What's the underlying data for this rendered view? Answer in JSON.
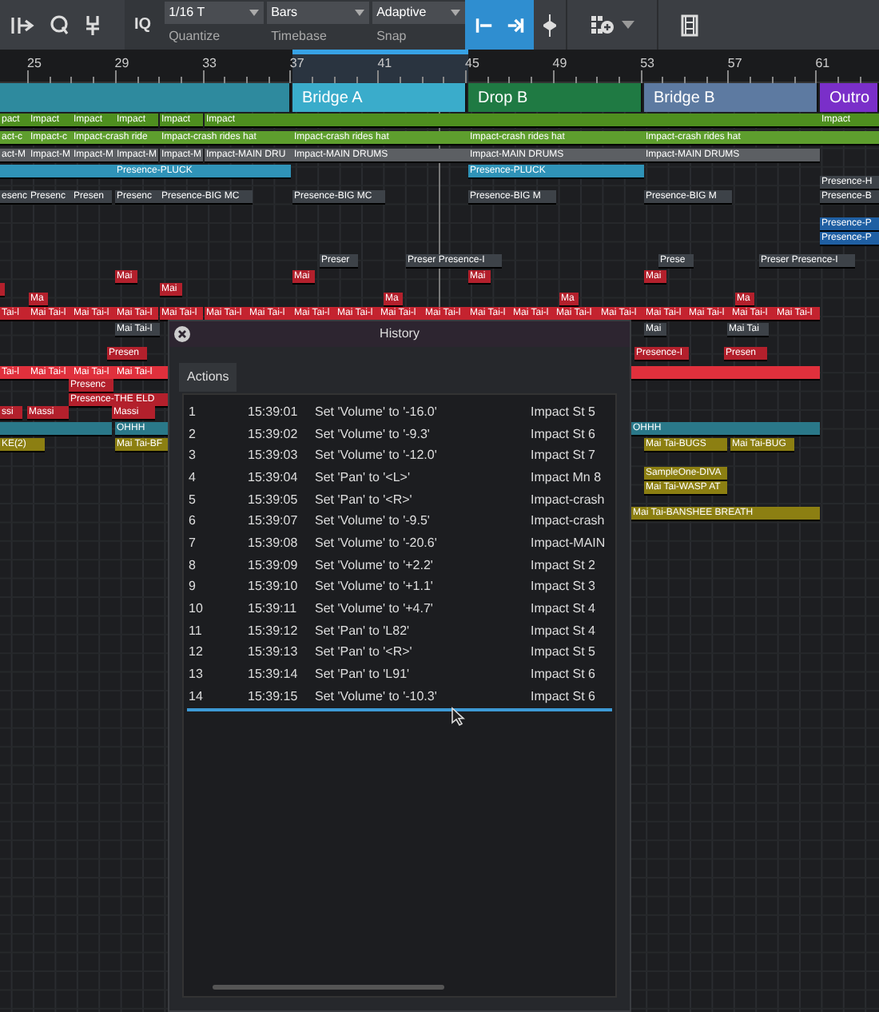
{
  "toolbar": {
    "quantize_label": "IQ",
    "dropdowns": [
      {
        "value": "1/16 T",
        "caption": "Quantize"
      },
      {
        "value": "Bars",
        "caption": "Timebase"
      },
      {
        "value": "Adaptive",
        "caption": "Snap"
      }
    ]
  },
  "ruler": [
    "25",
    "29",
    "33",
    "37",
    "41",
    "45",
    "49",
    "53",
    "57",
    "61"
  ],
  "sections": [
    {
      "color": "#2e8a9e"
    },
    {
      "label": "Bridge A",
      "color": "#3aaccb"
    },
    {
      "label": "Drop B",
      "color": "#1f7a43"
    },
    {
      "label": "Bridge B",
      "color": "#5d7aa1"
    },
    {
      "label": "Outro",
      "color": "#7a2fc9"
    }
  ],
  "lanes": [
    {
      "color": "#4e8f1f",
      "clips": [
        {
          "kind": "clip",
          "label": "pact"
        },
        {
          "kind": "clip",
          "label": "Impact"
        },
        {
          "kind": "clip",
          "label": "Impact"
        },
        {
          "kind": "clip",
          "label": "Impact"
        },
        {
          "kind": "clip",
          "label": "Impact"
        },
        {
          "kind": "clip",
          "label": "Impact"
        },
        {
          "kind": "bar"
        },
        {
          "kind": "clip",
          "label": "Impact"
        }
      ]
    },
    {
      "color": "#5e9e2e",
      "clips": [
        {
          "kind": "clip",
          "label": "act-c"
        },
        {
          "kind": "clip",
          "label": "Impact-c"
        },
        {
          "kind": "clip",
          "label": "Impact-crash ride"
        },
        {
          "kind": "clip",
          "label": "Impact-crash rides hat"
        },
        {
          "kind": "clip",
          "label": "Impact-crash rides hat"
        },
        {
          "kind": "clip",
          "label": "Impact-crash rides hat"
        },
        {
          "kind": "clip",
          "label": "Impact-crash rides hat"
        },
        {
          "kind": "bar"
        }
      ]
    },
    {
      "color": "#5c5f63",
      "clips": [
        "act-M",
        "Impact-M",
        "Impact-M",
        "Impact-M",
        "Impact-M",
        "Impact-MAIN DRU",
        "Impact-MAIN DRUMS",
        "Impact-MAIN DRUMS",
        "Impact-MAIN DRUMS"
      ]
    },
    {
      "color": "#2f93b8",
      "clips": [
        {
          "kind": "bar"
        },
        {
          "kind": "clip",
          "label": "Presence-PLUCK"
        },
        {
          "kind": "clip",
          "label": "Presence-PLUCK"
        }
      ]
    },
    {
      "color": "#3d4248",
      "clips": [
        "Presence-H"
      ]
    },
    {
      "color": "#3d4248",
      "clips": [
        "esenc",
        "Presenc",
        "Presen",
        "Presenc",
        "Presence-BIG MC",
        "Presence-BIG MC",
        "Presence-BIG M",
        "Presence-BIG M",
        "Presence-B"
      ]
    },
    {
      "color": "#1f5fa3",
      "clips": [
        "Presence-P"
      ]
    },
    {
      "color": "#1f5fa3",
      "clips": [
        "Presence-P"
      ]
    },
    {
      "color": "#3d4248",
      "clips": [
        "Preser",
        "Preser Presence-I",
        "Prese",
        "Preser Presence-I"
      ]
    },
    {
      "color": "#b3202c",
      "clips": [
        "Mai",
        "Mai",
        "Mai",
        "Mai"
      ]
    },
    {
      "color": "#b3202c",
      "clips": [
        {
          "kind": "bar"
        },
        {
          "kind": "clip",
          "label": "Mai"
        }
      ]
    },
    {
      "color": "#b3202c",
      "clips": [
        "Ma",
        "Ma",
        "Ma",
        "Ma"
      ]
    },
    {
      "color": "#c4232f",
      "clips": [
        "Tai-l",
        "Mai Tai-l",
        "Mai Tai-l",
        "Mai Tai-l",
        "Mai Tai-l",
        "Mai Tai-l",
        "Mai Tai-l",
        "Mai Tai-l",
        "Mai Tai-l",
        "Mai Tai-l",
        "Mai Tai-l",
        "Mai Tai-l",
        "Mai Tai-l",
        "Mai Tai-l",
        "Mai Tai-l",
        "Mai Tai-l",
        "Mai Tai-l",
        "Mai Tai-l",
        "Mai Tai-l"
      ]
    },
    {
      "color": "#3d4248",
      "clips": [
        "Mai Tai-l",
        "Mai",
        "Mai Tai"
      ]
    },
    {
      "color": "#b3202c",
      "clips": [
        "Presen",
        "Presence-I",
        "Presen"
      ]
    },
    {
      "color": "#e0303c",
      "clips": [
        {
          "kind": "clip",
          "label": "Tai-l"
        },
        {
          "kind": "clip",
          "label": "Mai Tai-l"
        },
        {
          "kind": "clip",
          "label": "Mai Tai-l"
        },
        {
          "kind": "clip",
          "label": "Mai Tai-l"
        },
        {
          "kind": "bar"
        }
      ]
    },
    {
      "color": "#b3202c",
      "clips": [
        "Presenc"
      ]
    },
    {
      "color": "#b3202c",
      "clips": [
        "Presence-THE ELD"
      ]
    },
    {
      "color": "#b3202c",
      "clips": [
        "ssi",
        "Massi",
        "Massi"
      ]
    },
    {
      "color": "#2a7889",
      "clips": [
        {
          "kind": "bar"
        },
        {
          "kind": "clip",
          "label": "OHHH"
        },
        {
          "kind": "clip",
          "label": "OHHH"
        }
      ]
    },
    {
      "color": "#8c7f12",
      "clips": [
        "KE(2)",
        "Mai Tai-BF",
        "Mai Tai-BUGS",
        "Mai Tai-BUG"
      ]
    },
    {
      "color": "#8c7f12",
      "clips": [
        "SampleOne-DIVA"
      ]
    },
    {
      "color": "#8c7f12",
      "clips": [
        "Mai Tai-WASP AT"
      ]
    },
    {
      "color": "#8c7f12",
      "clips": [
        "Mai Tai-BANSHEE BREATH"
      ]
    }
  ],
  "history": {
    "title": "History",
    "tab": "Actions",
    "rows": [
      {
        "index": "1",
        "time": "15:39:01",
        "action": "Set 'Volume' to '-16.0'",
        "track": "Impact St 5"
      },
      {
        "index": "2",
        "time": "15:39:02",
        "action": "Set 'Volume' to '-9.3'",
        "track": "Impact St 6"
      },
      {
        "index": "3",
        "time": "15:39:03",
        "action": "Set 'Volume' to '-12.0'",
        "track": "Impact St 7"
      },
      {
        "index": "4",
        "time": "15:39:04",
        "action": "Set 'Pan' to '<L>'",
        "track": "Impact Mn 8"
      },
      {
        "index": "5",
        "time": "15:39:05",
        "action": "Set 'Pan' to '<R>'",
        "track": "Impact-crash"
      },
      {
        "index": "6",
        "time": "15:39:07",
        "action": "Set 'Volume' to '-9.5'",
        "track": "Impact-crash"
      },
      {
        "index": "7",
        "time": "15:39:08",
        "action": "Set 'Volume' to '-20.6'",
        "track": "Impact-MAIN"
      },
      {
        "index": "8",
        "time": "15:39:09",
        "action": "Set 'Volume' to '+2.2'",
        "track": "Impact St 2"
      },
      {
        "index": "9",
        "time": "15:39:10",
        "action": "Set 'Volume' to '+1.1'",
        "track": "Impact St 3"
      },
      {
        "index": "10",
        "time": "15:39:11",
        "action": "Set 'Volume' to '+4.7'",
        "track": "Impact St 4"
      },
      {
        "index": "11",
        "time": "15:39:12",
        "action": "Set 'Pan' to 'L82'",
        "track": "Impact St 4"
      },
      {
        "index": "12",
        "time": "15:39:13",
        "action": "Set 'Pan' to '<R>'",
        "track": "Impact St 5"
      },
      {
        "index": "13",
        "time": "15:39:14",
        "action": "Set 'Pan' to 'L91'",
        "track": "Impact St 6"
      },
      {
        "index": "14",
        "time": "15:39:15",
        "action": "Set 'Volume' to '-10.3'",
        "track": "Impact St 6"
      }
    ]
  }
}
